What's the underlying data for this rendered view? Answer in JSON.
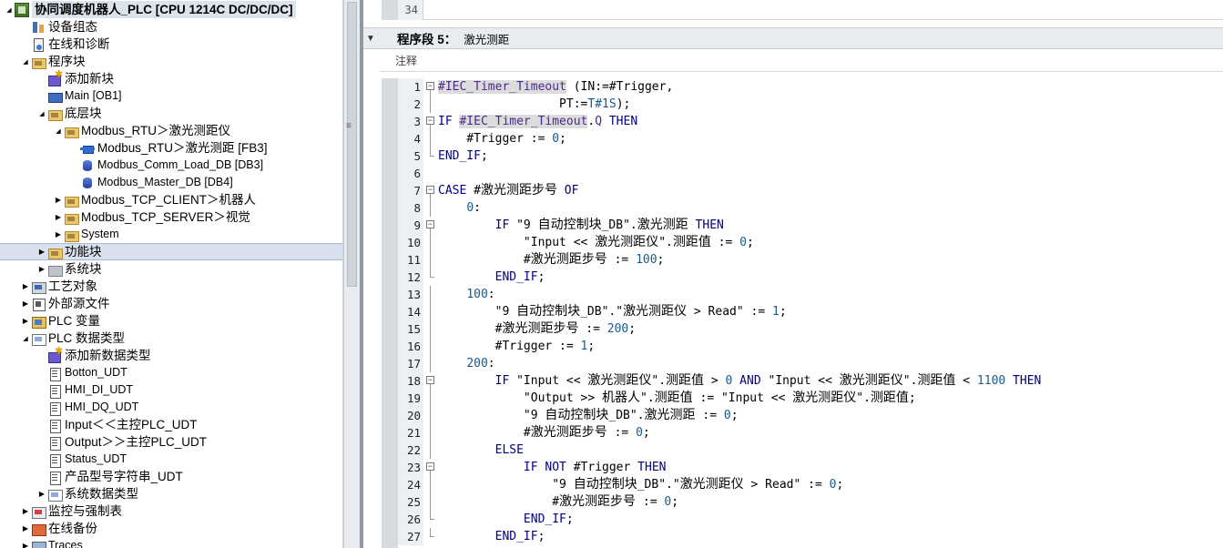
{
  "tree": {
    "items": [
      {
        "label": "协同调度机器人_PLC [CPU 1214C DC/DC/DC]",
        "icon": "plc-icon",
        "level": 0,
        "arrow": "down",
        "kind": "plc",
        "title": true
      },
      {
        "label": "设备组态",
        "icon": "device-config-icon",
        "level": 1,
        "arrow": "",
        "kind": "device"
      },
      {
        "label": "在线和诊断",
        "icon": "diagnostics-icon",
        "level": 1,
        "arrow": "",
        "kind": "diag"
      },
      {
        "label": "程序块",
        "icon": "folder-icon",
        "level": 1,
        "arrow": "down",
        "kind": "folder"
      },
      {
        "label": "添加新块",
        "icon": "add-block-icon",
        "level": 2,
        "arrow": "",
        "kind": "add"
      },
      {
        "label": "Main [OB1]",
        "icon": "ob-icon",
        "level": 2,
        "arrow": "",
        "kind": "ob",
        "small": true
      },
      {
        "label": "底层块",
        "icon": "folder-icon",
        "level": 2,
        "arrow": "down",
        "kind": "folder"
      },
      {
        "label": "Modbus_RTU＞激光测距仪",
        "icon": "folder-icon",
        "level": 3,
        "arrow": "down",
        "kind": "folder"
      },
      {
        "label": "Modbus_RTU＞激光测距 [FB3]",
        "icon": "fb-icon",
        "level": 4,
        "arrow": "",
        "kind": "fb"
      },
      {
        "label": "Modbus_Comm_Load_DB [DB3]",
        "icon": "db-icon",
        "level": 4,
        "arrow": "",
        "kind": "db",
        "small": true
      },
      {
        "label": "Modbus_Master_DB [DB4]",
        "icon": "db-icon",
        "level": 4,
        "arrow": "",
        "kind": "db",
        "small": true
      },
      {
        "label": "Modbus_TCP_CLIENT＞机器人",
        "icon": "folder-icon",
        "level": 3,
        "arrow": "right",
        "kind": "folder"
      },
      {
        "label": "Modbus_TCP_SERVER＞视觉",
        "icon": "folder-icon",
        "level": 3,
        "arrow": "right",
        "kind": "folder"
      },
      {
        "label": "System",
        "icon": "folder-icon",
        "level": 3,
        "arrow": "right",
        "kind": "folder",
        "small": true
      },
      {
        "label": "功能块",
        "icon": "folder-icon",
        "level": 2,
        "arrow": "right",
        "kind": "folder",
        "selected": true
      },
      {
        "label": "系统块",
        "icon": "system-block-icon",
        "level": 2,
        "arrow": "right",
        "kind": "sys"
      },
      {
        "label": "工艺对象",
        "icon": "technology-object-icon",
        "level": 1,
        "arrow": "right",
        "kind": "tech"
      },
      {
        "label": "外部源文件",
        "icon": "external-source-icon",
        "level": 1,
        "arrow": "right",
        "kind": "ext"
      },
      {
        "label": "PLC 变量",
        "icon": "plc-tags-icon",
        "level": 1,
        "arrow": "right",
        "kind": "tag"
      },
      {
        "label": "PLC 数据类型",
        "icon": "data-type-icon",
        "level": 1,
        "arrow": "down",
        "kind": "type"
      },
      {
        "label": "添加新数据类型",
        "icon": "add-type-icon",
        "level": 2,
        "arrow": "",
        "kind": "add"
      },
      {
        "label": "Botton_UDT",
        "icon": "udt-icon",
        "level": 2,
        "arrow": "",
        "kind": "udt",
        "small": true
      },
      {
        "label": "HMI_DI_UDT",
        "icon": "udt-icon",
        "level": 2,
        "arrow": "",
        "kind": "udt",
        "small": true
      },
      {
        "label": "HMI_DQ_UDT",
        "icon": "udt-icon",
        "level": 2,
        "arrow": "",
        "kind": "udt",
        "small": true
      },
      {
        "label": "Input＜＜主控PLC_UDT",
        "icon": "udt-icon",
        "level": 2,
        "arrow": "",
        "kind": "udt"
      },
      {
        "label": "Output＞＞主控PLC_UDT",
        "icon": "udt-icon",
        "level": 2,
        "arrow": "",
        "kind": "udt"
      },
      {
        "label": "Status_UDT",
        "icon": "udt-icon",
        "level": 2,
        "arrow": "",
        "kind": "udt",
        "small": true
      },
      {
        "label": "产品型号字符串_UDT",
        "icon": "udt-icon",
        "level": 2,
        "arrow": "",
        "kind": "udt"
      },
      {
        "label": "系统数据类型",
        "icon": "system-type-icon",
        "level": 2,
        "arrow": "right",
        "kind": "type"
      },
      {
        "label": "监控与强制表",
        "icon": "watch-table-icon",
        "level": 1,
        "arrow": "right",
        "kind": "watch"
      },
      {
        "label": "在线备份",
        "icon": "online-backup-icon",
        "level": 1,
        "arrow": "right",
        "kind": "backup"
      },
      {
        "label": "Traces",
        "icon": "traces-icon",
        "level": 1,
        "arrow": "right",
        "kind": "trace",
        "small": true
      }
    ]
  },
  "editor": {
    "prev_line_number": "34",
    "network_title": "程序段 5：",
    "network_name": "激光测距",
    "comment_label": "注释",
    "lines": [
      {
        "n": "1",
        "fold": "start",
        "indent": 0,
        "segs": [
          [
            "tmr hl",
            "#IEC_Timer_Timeout"
          ],
          [
            "s",
            " (IN:=#Trigger,"
          ]
        ]
      },
      {
        "n": "2",
        "fold": "line",
        "indent": 0,
        "segs": [
          [
            "s",
            "                 PT:="
          ],
          [
            "num-c",
            "T#1S"
          ],
          [
            "s",
            ");"
          ]
        ]
      },
      {
        "n": "3",
        "fold": "start",
        "indent": 0,
        "segs": [
          [
            "k",
            "IF "
          ],
          [
            "tmr hl",
            "#IEC_Timer_Timeout"
          ],
          [
            "s",
            "."
          ],
          [
            "tmr",
            "Q"
          ],
          [
            "k",
            " THEN"
          ]
        ]
      },
      {
        "n": "4",
        "fold": "line",
        "indent": 0,
        "segs": [
          [
            "s",
            "    #Trigger := "
          ],
          [
            "num-c",
            "0"
          ],
          [
            "s",
            ";"
          ]
        ]
      },
      {
        "n": "5",
        "fold": "end",
        "indent": 0,
        "segs": [
          [
            "k",
            "END_IF"
          ],
          [
            "s",
            ";"
          ]
        ]
      },
      {
        "n": "6",
        "fold": "",
        "indent": 0,
        "segs": [
          [
            "s",
            ""
          ]
        ]
      },
      {
        "n": "7",
        "fold": "start",
        "indent": 0,
        "segs": [
          [
            "k",
            "CASE "
          ],
          [
            "s",
            "#"
          ],
          [
            "cn",
            "激光测距步号"
          ],
          [
            "k",
            " OF"
          ]
        ]
      },
      {
        "n": "8",
        "fold": "line",
        "indent": 0,
        "segs": [
          [
            "s",
            "    "
          ],
          [
            "num-c",
            "0"
          ],
          [
            "s",
            ":"
          ]
        ]
      },
      {
        "n": "9",
        "fold": "start",
        "indent": 0,
        "segs": [
          [
            "s",
            "        "
          ],
          [
            "k",
            "IF "
          ],
          [
            "s",
            "\"9 "
          ],
          [
            "cn",
            "自动控制块"
          ],
          [
            "s",
            "_DB\"."
          ],
          [
            "cn",
            "激光测距"
          ],
          [
            "k",
            " THEN"
          ]
        ]
      },
      {
        "n": "10",
        "fold": "line",
        "indent": 0,
        "segs": [
          [
            "s",
            "            \"Input << "
          ],
          [
            "cn",
            "激光测距仪"
          ],
          [
            "s",
            "\"."
          ],
          [
            "cn",
            "测距值"
          ],
          [
            "s",
            " := "
          ],
          [
            "num-c",
            "0"
          ],
          [
            "s",
            ";"
          ]
        ]
      },
      {
        "n": "11",
        "fold": "line",
        "indent": 0,
        "segs": [
          [
            "s",
            "            #"
          ],
          [
            "cn",
            "激光测距步号"
          ],
          [
            "s",
            " := "
          ],
          [
            "num-c",
            "100"
          ],
          [
            "s",
            ";"
          ]
        ]
      },
      {
        "n": "12",
        "fold": "end",
        "indent": 0,
        "segs": [
          [
            "s",
            "        "
          ],
          [
            "k",
            "END_IF"
          ],
          [
            "s",
            ";"
          ]
        ]
      },
      {
        "n": "13",
        "fold": "line",
        "indent": 0,
        "segs": [
          [
            "s",
            "    "
          ],
          [
            "num-c",
            "100"
          ],
          [
            "s",
            ":"
          ]
        ]
      },
      {
        "n": "14",
        "fold": "line",
        "indent": 0,
        "segs": [
          [
            "s",
            "        \"9 "
          ],
          [
            "cn",
            "自动控制块"
          ],
          [
            "s",
            "_DB\".\""
          ],
          [
            "cn",
            "激光测距仪"
          ],
          [
            "s",
            " > Read\" := "
          ],
          [
            "num-c",
            "1"
          ],
          [
            "s",
            ";"
          ]
        ]
      },
      {
        "n": "15",
        "fold": "line",
        "indent": 0,
        "segs": [
          [
            "s",
            "        #"
          ],
          [
            "cn",
            "激光测距步号"
          ],
          [
            "s",
            " := "
          ],
          [
            "num-c",
            "200"
          ],
          [
            "s",
            ";"
          ]
        ]
      },
      {
        "n": "16",
        "fold": "line",
        "indent": 0,
        "segs": [
          [
            "s",
            "        #Trigger := "
          ],
          [
            "num-c",
            "1"
          ],
          [
            "s",
            ";"
          ]
        ]
      },
      {
        "n": "17",
        "fold": "line",
        "indent": 0,
        "segs": [
          [
            "s",
            "    "
          ],
          [
            "num-c",
            "200"
          ],
          [
            "s",
            ":"
          ]
        ]
      },
      {
        "n": "18",
        "fold": "start",
        "indent": 0,
        "segs": [
          [
            "s",
            "        "
          ],
          [
            "k",
            "IF "
          ],
          [
            "s",
            "\"Input << "
          ],
          [
            "cn",
            "激光测距仪"
          ],
          [
            "s",
            "\"."
          ],
          [
            "cn",
            "测距值"
          ],
          [
            "s",
            " > "
          ],
          [
            "num-c",
            "0"
          ],
          [
            "k",
            " AND "
          ],
          [
            "s",
            "\"Input << "
          ],
          [
            "cn",
            "激光测距仪"
          ],
          [
            "s",
            "\"."
          ],
          [
            "cn",
            "测距值"
          ],
          [
            "s",
            " < "
          ],
          [
            "num-c",
            "1100"
          ],
          [
            "k",
            " THEN"
          ]
        ]
      },
      {
        "n": "19",
        "fold": "line",
        "indent": 0,
        "segs": [
          [
            "s",
            "            \"Output >> "
          ],
          [
            "cn",
            "机器人"
          ],
          [
            "s",
            "\"."
          ],
          [
            "cn",
            "测距值"
          ],
          [
            "s",
            " := \"Input << "
          ],
          [
            "cn",
            "激光测距仪"
          ],
          [
            "s",
            "\"."
          ],
          [
            "cn",
            "测距值"
          ],
          [
            "s",
            ";"
          ]
        ]
      },
      {
        "n": "20",
        "fold": "line",
        "indent": 0,
        "segs": [
          [
            "s",
            "            \"9 "
          ],
          [
            "cn",
            "自动控制块"
          ],
          [
            "s",
            "_DB\"."
          ],
          [
            "cn",
            "激光测距"
          ],
          [
            "s",
            " := "
          ],
          [
            "num-c",
            "0"
          ],
          [
            "s",
            ";"
          ]
        ]
      },
      {
        "n": "21",
        "fold": "line",
        "indent": 0,
        "segs": [
          [
            "s",
            "            #"
          ],
          [
            "cn",
            "激光测距步号"
          ],
          [
            "s",
            " := "
          ],
          [
            "num-c",
            "0"
          ],
          [
            "s",
            ";"
          ]
        ]
      },
      {
        "n": "22",
        "fold": "line",
        "indent": 0,
        "segs": [
          [
            "s",
            "        "
          ],
          [
            "k",
            "ELSE"
          ]
        ]
      },
      {
        "n": "23",
        "fold": "start",
        "indent": 0,
        "segs": [
          [
            "s",
            "            "
          ],
          [
            "k",
            "IF NOT "
          ],
          [
            "s",
            "#Trigger "
          ],
          [
            "k",
            "THEN"
          ]
        ]
      },
      {
        "n": "24",
        "fold": "line",
        "indent": 0,
        "segs": [
          [
            "s",
            "                \"9 "
          ],
          [
            "cn",
            "自动控制块"
          ],
          [
            "s",
            "_DB\".\""
          ],
          [
            "cn",
            "激光测距仪"
          ],
          [
            "s",
            " > Read\" := "
          ],
          [
            "num-c",
            "0"
          ],
          [
            "s",
            ";"
          ]
        ]
      },
      {
        "n": "25",
        "fold": "line",
        "indent": 0,
        "segs": [
          [
            "s",
            "                #"
          ],
          [
            "cn",
            "激光测距步号"
          ],
          [
            "s",
            " := "
          ],
          [
            "num-c",
            "0"
          ],
          [
            "s",
            ";"
          ]
        ]
      },
      {
        "n": "26",
        "fold": "end",
        "indent": 0,
        "segs": [
          [
            "s",
            "            "
          ],
          [
            "k",
            "END_IF"
          ],
          [
            "s",
            ";"
          ]
        ]
      },
      {
        "n": "27",
        "fold": "end",
        "indent": 0,
        "segs": [
          [
            "s",
            "        "
          ],
          [
            "k",
            "END_IF"
          ],
          [
            "s",
            ";"
          ]
        ]
      }
    ]
  },
  "colors": {
    "selected_row": "#d9e1ef",
    "keyword": "#000080",
    "number": "#1a5a8a",
    "gutter": "#d7dbe0"
  }
}
